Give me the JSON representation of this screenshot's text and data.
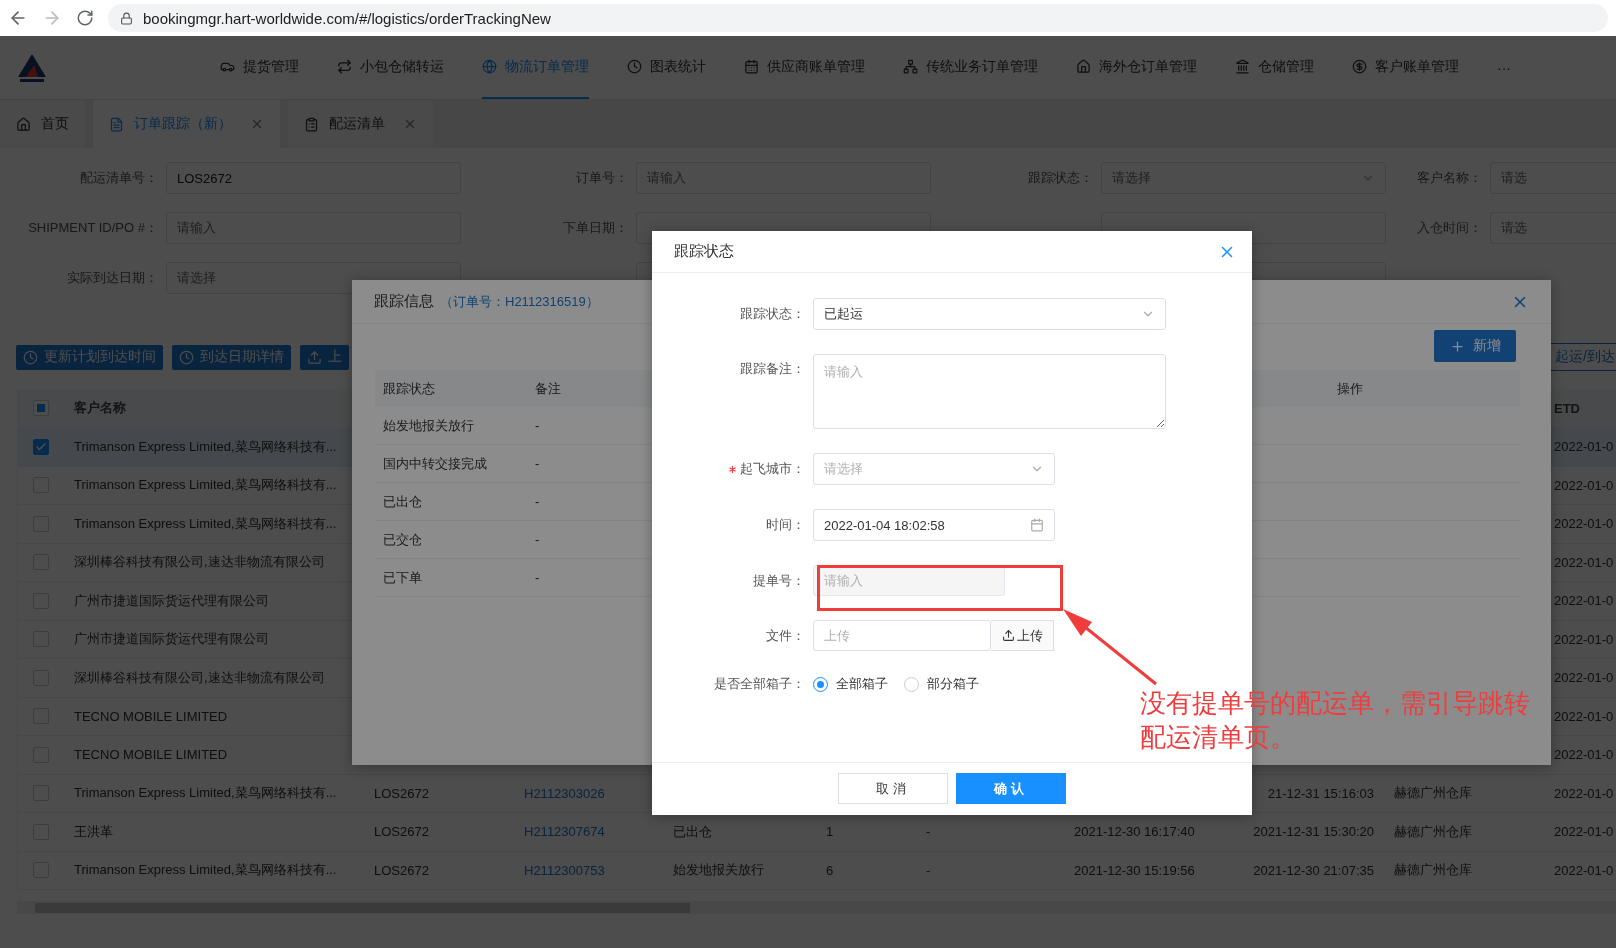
{
  "browser": {
    "url": "bookingmgr.hart-worldwide.com/#/logistics/orderTrackingNew"
  },
  "nav": {
    "items": [
      {
        "label": "提货管理",
        "selected": false
      },
      {
        "label": "小包仓储转运",
        "selected": false
      },
      {
        "label": "物流订单管理",
        "selected": true
      },
      {
        "label": "图表统计",
        "selected": false
      },
      {
        "label": "供应商账单管理",
        "selected": false
      },
      {
        "label": "传统业务订单管理",
        "selected": false
      },
      {
        "label": "海外仓订单管理",
        "selected": false
      },
      {
        "label": "仓储管理",
        "selected": false
      },
      {
        "label": "客户账单管理",
        "selected": false
      }
    ],
    "more": "···"
  },
  "tabs": [
    {
      "label": "首页",
      "selected": false,
      "closable": false
    },
    {
      "label": "订单跟踪（新）",
      "selected": true,
      "closable": true
    },
    {
      "label": "配运清单",
      "selected": false,
      "closable": true
    }
  ],
  "filters": [
    [
      {
        "label": "配运清单号：",
        "kind": "input",
        "value": "LOS2672"
      },
      {
        "label": "订单号：",
        "kind": "input",
        "placeholder": "请输入"
      },
      {
        "label": "跟踪状态：",
        "kind": "select",
        "placeholder": "请选择"
      },
      {
        "label": "客户名称：",
        "kind": "input",
        "placeholder": "请选"
      }
    ],
    [
      {
        "label": "SHIPMENT ID/PO #：",
        "kind": "input",
        "placeholder": "请输入"
      },
      {
        "label": "下单日期：",
        "kind": "input"
      },
      {
        "kind": "input"
      },
      {
        "label": "入仓时间：",
        "kind": "input",
        "placeholder": "请选"
      }
    ],
    [
      {
        "label": "实际到达日期：",
        "kind": "input",
        "placeholder": "请选择"
      },
      {
        "kind": "input"
      },
      {
        "kind": "input"
      }
    ]
  ],
  "toolbar": {
    "buttons": [
      "更新计划到达时间",
      "到达日期详情",
      "上"
    ],
    "right_button": "起运/到达"
  },
  "table": {
    "header_checkbox": {
      "indeterminate": true
    },
    "columns": [
      "客户名称",
      null,
      null,
      null,
      null,
      null,
      null,
      null,
      null,
      "ETD"
    ],
    "rows": [
      {
        "selected": true,
        "cells": [
          "Trimanson Express Limited,菜鸟网络科技有...",
          null,
          null,
          null,
          null,
          null,
          null,
          null,
          null,
          "2022-01-0"
        ]
      },
      {
        "selected": false,
        "cells": [
          "Trimanson Express Limited,菜鸟网络科技有...",
          null,
          null,
          null,
          null,
          null,
          null,
          null,
          null,
          "2022-01-0"
        ]
      },
      {
        "selected": false,
        "cells": [
          "Trimanson Express Limited,菜鸟网络科技有...",
          null,
          null,
          null,
          null,
          null,
          null,
          null,
          null,
          "2022-01-0"
        ]
      },
      {
        "selected": false,
        "cells": [
          "深圳棒谷科技有限公司,速达非物流有限公司",
          null,
          null,
          null,
          null,
          null,
          null,
          null,
          null,
          "2022-01-0"
        ]
      },
      {
        "selected": false,
        "cells": [
          "广州市捷道国际货运代理有限公司",
          null,
          null,
          null,
          null,
          null,
          null,
          null,
          null,
          "2022-01-0"
        ]
      },
      {
        "selected": false,
        "cells": [
          "广州市捷道国际货运代理有限公司",
          null,
          null,
          null,
          null,
          null,
          null,
          null,
          null,
          "2022-01-0"
        ]
      },
      {
        "selected": false,
        "cells": [
          "深圳棒谷科技有限公司,速达非物流有限公司",
          null,
          null,
          null,
          null,
          null,
          null,
          null,
          null,
          "2022-01-0"
        ]
      },
      {
        "selected": false,
        "cells": [
          "TECNO MOBILE LIMITED",
          null,
          null,
          null,
          null,
          null,
          null,
          null,
          null,
          "2022-01-0"
        ]
      },
      {
        "selected": false,
        "cells": [
          "TECNO MOBILE LIMITED",
          null,
          null,
          null,
          null,
          null,
          null,
          null,
          null,
          "2022-01-0"
        ]
      },
      {
        "selected": false,
        "cells": [
          "Trimanson Express Limited,菜鸟网络科技有...",
          "LOS2672",
          "H2112303026",
          null,
          null,
          null,
          null,
          "21-12-31 15:16:03",
          "赫德广州仓库",
          "2022-01-0"
        ]
      },
      {
        "selected": false,
        "cells": [
          "王洪革",
          "LOS2672",
          "H2112307674",
          "已出仓",
          "1",
          "-",
          "2021-12-30 16:17:40",
          "2021-12-31 15:30:20",
          "赫德广州仓库",
          "2022-01-0"
        ]
      },
      {
        "selected": false,
        "cells": [
          "Trimanson Express Limited,菜鸟网络科技有...",
          "LOS2672",
          "H2112300753",
          "始发地报关放行",
          "6",
          "-",
          "2021-12-30 15:19:56",
          "2021-12-30 21:07:35",
          "赫德广州仓库",
          "2022-01-0"
        ]
      }
    ]
  },
  "tracking_modal": {
    "title": "跟踪信息",
    "order_ref": "（订单号：H2112316519）",
    "add_button": "新增",
    "columns": [
      "跟踪状态",
      "备注",
      "操作"
    ],
    "rows": [
      [
        "始发地报关放行",
        "-"
      ],
      [
        "国内中转交接完成",
        "-"
      ],
      [
        "已出仓",
        "-"
      ],
      [
        "已交仓",
        "-"
      ],
      [
        "已下单",
        "-"
      ]
    ]
  },
  "status_dialog": {
    "title": "跟踪状态",
    "fields": [
      {
        "kind": "select",
        "label": "跟踪状态：",
        "value": "已起运",
        "required": false
      },
      {
        "kind": "textarea",
        "label": "跟踪备注：",
        "placeholder": "请输入",
        "required": false
      },
      {
        "kind": "select",
        "label": "起飞城市：",
        "placeholder": "请选择",
        "required": true
      },
      {
        "kind": "date",
        "label": "时间：",
        "value": "2022-01-04 18:02:58",
        "required": false
      },
      {
        "kind": "input",
        "label": "提单号：",
        "placeholder": "请输入",
        "disabled": true,
        "required": false
      },
      {
        "kind": "upload",
        "label": "文件：",
        "placeholder": "上传",
        "button": "上传",
        "required": false
      },
      {
        "kind": "radio",
        "label": "是否全部箱子：",
        "required": false,
        "options": [
          {
            "label": "全部箱子",
            "selected": true
          },
          {
            "label": "部分箱子",
            "selected": false
          }
        ]
      }
    ],
    "buttons": {
      "cancel": "取消",
      "confirm": "确认"
    }
  },
  "annotation": {
    "text": "没有提单号的配运单，需引导跳转配运清单页。"
  }
}
